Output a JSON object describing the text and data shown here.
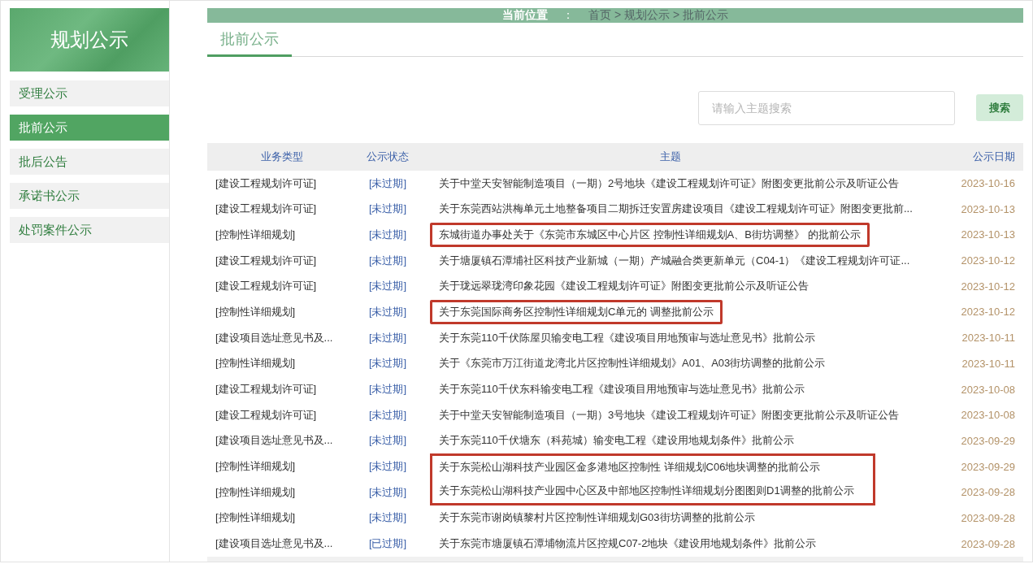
{
  "sidebar": {
    "title": "规划公示",
    "items": [
      {
        "label": "受理公示",
        "selected": false
      },
      {
        "label": "批前公示",
        "selected": true
      },
      {
        "label": "批后公告",
        "selected": false
      },
      {
        "label": "承诺书公示",
        "selected": false
      },
      {
        "label": "处罚案件公示",
        "selected": false
      }
    ]
  },
  "breadcrumb": {
    "label": "当前位置",
    "colon": "：",
    "trail": "首页 > 规划公示 > 批前公示"
  },
  "tabs": [
    {
      "label": "批前公示",
      "selected": true
    }
  ],
  "search": {
    "placeholder": "请输入主题搜索",
    "button": "搜索"
  },
  "table": {
    "columns": [
      "业务类型",
      "公示状态",
      "主题",
      "公示日期"
    ],
    "rows": [
      {
        "type": "[建设工程规划许可证]",
        "status": "[未过期]",
        "subject": "关于中堂天安智能制造项目（一期）2号地块《建设工程规划许可证》附图变更批前公示及听证公告",
        "date": "2023-10-16",
        "highlighted": false
      },
      {
        "type": "[建设工程规划许可证]",
        "status": "[未过期]",
        "subject": "关于东莞西站洪梅单元土地整备项目二期拆迁安置房建设项目《建设工程规划许可证》附图变更批前...",
        "date": "2023-10-13",
        "highlighted": false
      },
      {
        "type": "[控制性详细规划]",
        "status": "[未过期]",
        "subject": "东城街道办事处关于《东莞市东城区中心片区 控制性详细规划A、B街坊调整》 的批前公示",
        "date": "2023-10-13",
        "highlighted": true
      },
      {
        "type": "[建设工程规划许可证]",
        "status": "[未过期]",
        "subject": "关于塘厦镇石潭埔社区科技产业新城（一期）产城融合类更新单元（C04-1）《建设工程规划许可证...",
        "date": "2023-10-12",
        "highlighted": false
      },
      {
        "type": "[建设工程规划许可证]",
        "status": "[未过期]",
        "subject": "关于珑远翠珑湾印象花园《建设工程规划许可证》附图变更批前公示及听证公告",
        "date": "2023-10-12",
        "highlighted": false
      },
      {
        "type": "[控制性详细规划]",
        "status": "[未过期]",
        "subject": "关于东莞国际商务区控制性详细规划C单元的 调整批前公示",
        "date": "2023-10-12",
        "highlighted": true
      },
      {
        "type": "[建设项目选址意见书及...",
        "status": "[未过期]",
        "subject": "关于东莞110千伏陈屋贝输变电工程《建设项目用地预审与选址意见书》批前公示",
        "date": "2023-10-11",
        "highlighted": false
      },
      {
        "type": "[控制性详细规划]",
        "status": "[未过期]",
        "subject": "关于《东莞市万江街道龙湾北片区控制性详细规划》A01、A03街坊调整的批前公示",
        "date": "2023-10-11",
        "highlighted": false
      },
      {
        "type": "[建设工程规划许可证]",
        "status": "[未过期]",
        "subject": "关于东莞110千伏东科输变电工程《建设项目用地预审与选址意见书》批前公示",
        "date": "2023-10-08",
        "highlighted": false
      },
      {
        "type": "[建设工程规划许可证]",
        "status": "[未过期]",
        "subject": "关于中堂天安智能制造项目（一期）3号地块《建设工程规划许可证》附图变更批前公示及听证公告",
        "date": "2023-10-08",
        "highlighted": false
      },
      {
        "type": "[建设项目选址意见书及...",
        "status": "[未过期]",
        "subject": "关于东莞110千伏塘东（科苑城）输变电工程《建设用地规划条件》批前公示",
        "date": "2023-09-29",
        "highlighted": false
      },
      {
        "type": "[控制性详细规划]",
        "status": "[未过期]",
        "subject": "关于东莞松山湖科技产业园区金多港地区控制性 详细规划C06地块调整的批前公示",
        "date": "2023-09-29",
        "highlighted": true
      },
      {
        "type": "[控制性详细规划]",
        "status": "[未过期]",
        "subject": "关于东莞松山湖科技产业园中心区及中部地区控制性详细规划分图图则D1调整的批前公示",
        "date": "2023-09-28",
        "highlighted": true
      },
      {
        "type": "[控制性详细规划]",
        "status": "[未过期]",
        "subject": "关于东莞市谢岗镇黎村片区控制性详细规划G03街坊调整的批前公示",
        "date": "2023-09-28",
        "highlighted": false
      },
      {
        "type": "[建设项目选址意见书及...",
        "status": "[已过期]",
        "subject": "关于东莞市塘厦镇石潭埔物流片区控规C07-2地块《建设用地规划条件》批前公示",
        "date": "2023-09-28",
        "highlighted": false
      }
    ]
  }
}
